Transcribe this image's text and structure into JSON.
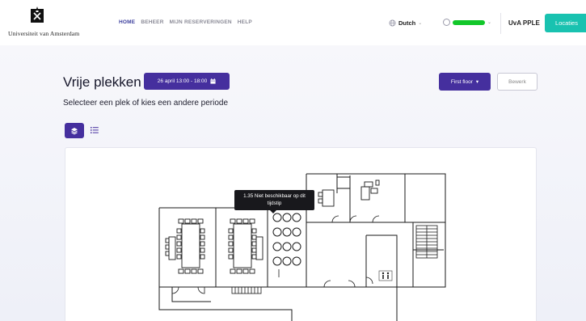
{
  "header": {
    "logo_text": "Universiteit van Amsterdam",
    "nav": [
      {
        "label": "HOME",
        "active": true
      },
      {
        "label": "BEHEER",
        "active": false
      },
      {
        "label": "MIJN RESERVERINGEN",
        "active": false
      },
      {
        "label": "HELP",
        "active": false
      }
    ],
    "language": "Dutch",
    "organization": "UvA PPLE",
    "locations_button": "Locaties"
  },
  "page": {
    "title": "Vrije plekken",
    "date_button": "26 april 13:00 - 18:00",
    "floor_button": "First floor",
    "edit_button": "Bewerk",
    "subtitle": "Selecteer een plek of kies een andere periode"
  },
  "view_toggle": {
    "active": "map",
    "icons": [
      "layers-icon",
      "list-icon"
    ]
  },
  "tooltip": {
    "line1": "1.35 Niet beschikbaar op dit",
    "line2": "tijdstip"
  },
  "colors": {
    "primary": "#452f9e",
    "accent": "#19c2b0",
    "nav_active": "#3a3d9c",
    "user_redacted": "#12c72a"
  }
}
